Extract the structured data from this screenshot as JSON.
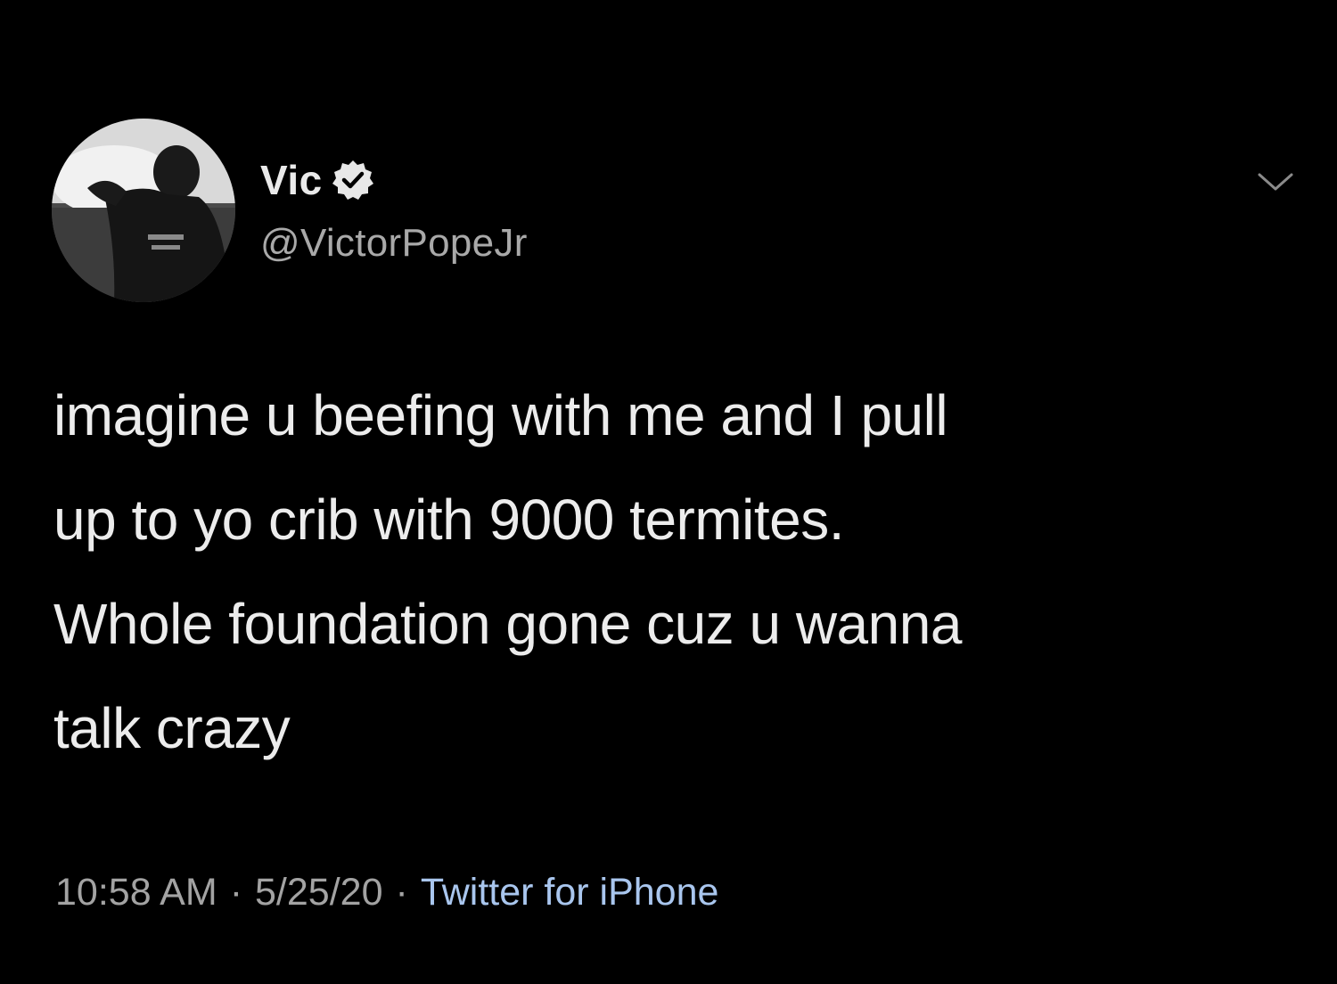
{
  "author": {
    "display_name": "Vic",
    "handle": "@VictorPopeJr",
    "verified_icon": "verified-badge-icon"
  },
  "tweet": {
    "text": "imagine u beefing with me and I pull\nup to yo crib with 9000 termites.\nWhole foundation gone cuz u wanna\ntalk crazy"
  },
  "meta": {
    "time": "10:58 AM",
    "separator": "·",
    "date": "5/25/20",
    "source": "Twitter for iPhone"
  },
  "icons": {
    "menu": "chevron-down-icon"
  },
  "colors": {
    "background": "#000000",
    "text": "#ececec",
    "secondary_text": "#a3a3a3",
    "source_link": "#a9c6ee",
    "verified_badge": "#e8e8e8"
  }
}
